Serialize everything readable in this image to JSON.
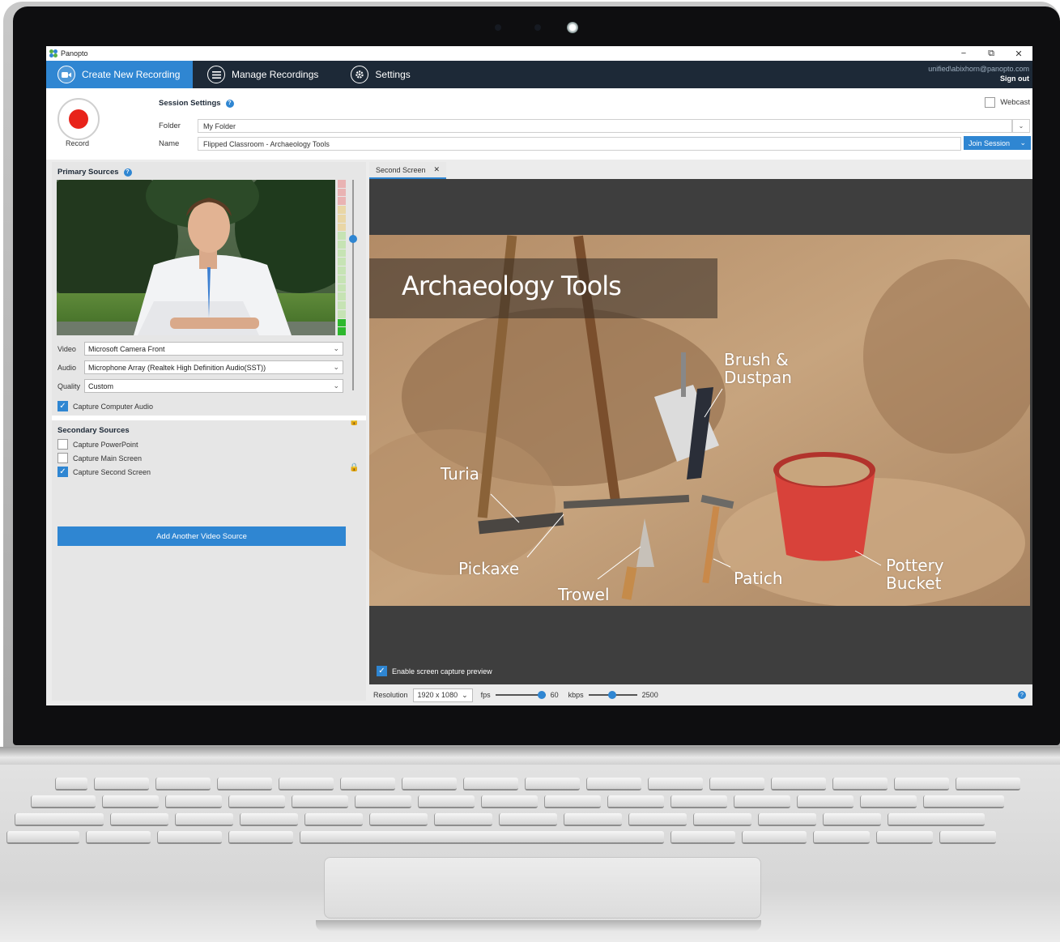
{
  "window": {
    "app_title": "Panopto",
    "controls": {
      "minimize": "−",
      "restore": "⧉",
      "close": "✕"
    }
  },
  "nav": {
    "tabs": [
      {
        "label": "Create New Recording",
        "icon": "video-camera-icon",
        "active": true
      },
      {
        "label": "Manage Recordings",
        "icon": "list-icon",
        "active": false
      },
      {
        "label": "Settings",
        "icon": "gear-icon",
        "active": false
      }
    ],
    "user_email": "unified\\abixhorn@panopto.com",
    "sign_out": "Sign out"
  },
  "session": {
    "record_label": "Record",
    "title": "Session Settings",
    "folder_label": "Folder",
    "folder_value": "My Folder",
    "name_label": "Name",
    "name_value": "Flipped Classroom - Archaeology Tools",
    "webcast_label": "Webcast",
    "webcast_checked": false,
    "join_session": "Join Session"
  },
  "primary_sources": {
    "title": "Primary Sources",
    "video_label": "Video",
    "video_value": "Microsoft Camera Front",
    "audio_label": "Audio",
    "audio_value": "Microphone Array (Realtek High Definition Audio(SST))",
    "quality_label": "Quality",
    "quality_value": "Custom",
    "capture_audio": "Capture Computer Audio",
    "capture_audio_checked": true
  },
  "secondary_sources": {
    "title": "Secondary Sources",
    "items": [
      {
        "label": "Capture PowerPoint",
        "checked": false
      },
      {
        "label": "Capture Main Screen",
        "checked": false
      },
      {
        "label": "Capture Second Screen",
        "checked": true
      }
    ],
    "add_button": "Add Another Video Source"
  },
  "preview": {
    "tab_label": "Second Screen",
    "tab_close": "✕",
    "slide_title": "Archaeology Tools",
    "labels": {
      "brush": "Brush &",
      "dustpan": "Dustpan",
      "turia": "Turia",
      "pickaxe": "Pickaxe",
      "trowel": "Trowel",
      "patich": "Patich",
      "pottery": "Pottery",
      "bucket": "Bucket"
    },
    "enable_preview": "Enable screen capture preview",
    "enable_checked": true,
    "resolution_label": "Resolution",
    "resolution_value": "1920 x 1080",
    "fps_label": "fps",
    "fps_value": "60",
    "kbps_label": "kbps",
    "kbps_value": "2500"
  },
  "colors": {
    "accent": "#2f86d2",
    "nav_bg": "#1d2937",
    "record_red": "#e8231a"
  }
}
